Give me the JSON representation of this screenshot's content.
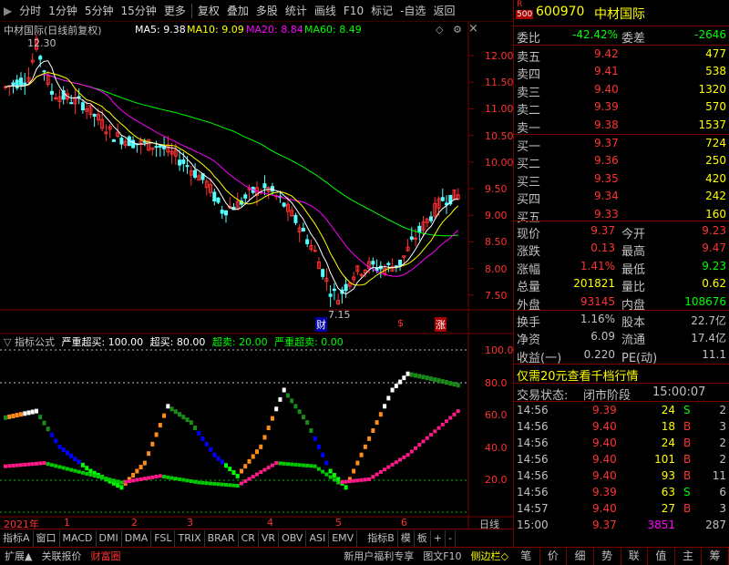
{
  "toolbar": {
    "items": [
      "分时",
      "1分钟",
      "5分钟",
      "15分钟",
      "更多",
      "复权",
      "叠加",
      "多股",
      "统计",
      "画线",
      "F10",
      "标记",
      "-自选",
      "返回"
    ]
  },
  "kline_header": {
    "title": "中材国际(日线前复权)",
    "ma5": "MA5: 9.38",
    "ma10": "MA10: 9.09",
    "ma20": "MA20: 8.84",
    "ma60": "MA60: 8.49",
    "high_mark": "12.30",
    "low_mark": "7.15",
    "ev1": "财",
    "ev2": "$",
    "ev3": "涨"
  },
  "price_axis": [
    "12.00",
    "11.50",
    "11.00",
    "10.50",
    "10.00",
    "9.50",
    "9.00",
    "8.50",
    "8.00",
    "7.50"
  ],
  "indicator": {
    "title": "指标公式",
    "p1": "严重超买: 100.00",
    "p2": "超买: 80.00",
    "p3": "超卖: 20.00",
    "p4": "严重超卖: 0.00",
    "axis": [
      "100.0",
      "80.0",
      "60.0",
      "40.0",
      "20.0"
    ]
  },
  "xaxis": {
    "labels": [
      "2021年",
      "1",
      "2",
      "3",
      "4",
      "5",
      "6"
    ],
    "period": "日线"
  },
  "tabs": [
    "指标A",
    "窗口",
    "MACD",
    "DMI",
    "DMA",
    "FSL",
    "TRIX",
    "BRAR",
    "CR",
    "VR",
    "OBV",
    "ASI",
    "EMV",
    "指标B",
    "模",
    "板",
    "+",
    "-"
  ],
  "bottom": {
    "items": [
      "扩展▲",
      "关联报价",
      "财富圈"
    ],
    "promo": "新用户福利专享",
    "f10": "图文F10",
    "side": "侧边栏◇"
  },
  "sidebar_bottom": [
    "笔",
    "价",
    "细",
    "势",
    "联",
    "值",
    "主",
    "筹"
  ],
  "quote": {
    "code": "600970",
    "name": "中材国际",
    "badge": "500",
    "rlabel": "R",
    "wb_label": "委比",
    "wb": "-42.42%",
    "wc_label": "委差",
    "wc": "-2646",
    "asks": [
      {
        "l": "卖五",
        "p": "9.42",
        "v": "477"
      },
      {
        "l": "卖四",
        "p": "9.41",
        "v": "538"
      },
      {
        "l": "卖三",
        "p": "9.40",
        "v": "1320"
      },
      {
        "l": "卖二",
        "p": "9.39",
        "v": "570"
      },
      {
        "l": "卖一",
        "p": "9.38",
        "v": "1537"
      }
    ],
    "bids": [
      {
        "l": "买一",
        "p": "9.37",
        "v": "724"
      },
      {
        "l": "买二",
        "p": "9.36",
        "v": "250"
      },
      {
        "l": "买三",
        "p": "9.35",
        "v": "420"
      },
      {
        "l": "买四",
        "p": "9.34",
        "v": "242"
      },
      {
        "l": "买五",
        "p": "9.33",
        "v": "160"
      }
    ],
    "stats": [
      {
        "l1": "现价",
        "v1": "9.37",
        "l2": "今开",
        "v2": "9.23"
      },
      {
        "l1": "涨跌",
        "v1": "0.13",
        "l2": "最高",
        "v2": "9.47"
      },
      {
        "l1": "涨幅",
        "v1": "1.41%",
        "l2": "最低",
        "v2": "9.23"
      },
      {
        "l1": "总量",
        "v1": "201821",
        "l2": "量比",
        "v2": "0.62"
      },
      {
        "l1": "外盘",
        "v1": "93145",
        "l2": "内盘",
        "v2": "108676"
      }
    ],
    "stats2": [
      {
        "l1": "换手",
        "v1": "1.16%",
        "l2": "股本",
        "v2": "22.7亿"
      },
      {
        "l1": "净资",
        "v1": "6.09",
        "l2": "流通",
        "v2": "17.4亿"
      },
      {
        "l1": "收益(一)",
        "v1": "0.220",
        "l2": "PE(动)",
        "v2": "11.1"
      }
    ],
    "promo": "仅需20元查看千档行情",
    "status_label": "交易状态:",
    "status": "闭市阶段",
    "status_time": "15:00:07",
    "ticks": [
      {
        "t": "14:56",
        "p": "9.39",
        "v": "24",
        "s": "S",
        "n": "2"
      },
      {
        "t": "14:56",
        "p": "9.40",
        "v": "18",
        "s": "B",
        "n": "3"
      },
      {
        "t": "14:56",
        "p": "9.40",
        "v": "24",
        "s": "B",
        "n": "2"
      },
      {
        "t": "14:56",
        "p": "9.40",
        "v": "101",
        "s": "B",
        "n": "2"
      },
      {
        "t": "14:56",
        "p": "9.40",
        "v": "93",
        "s": "B",
        "n": "11"
      },
      {
        "t": "14:56",
        "p": "9.39",
        "v": "63",
        "s": "S",
        "n": "6"
      },
      {
        "t": "14:57",
        "p": "9.40",
        "v": "27",
        "s": "B",
        "n": "3"
      },
      {
        "t": "15:00",
        "p": "9.37",
        "v": "3851",
        "s": "",
        "n": "287"
      }
    ]
  },
  "colors": {
    "up": "#ff3232",
    "down": "#54ffff",
    "ma5": "#ffffff",
    "ma10": "#ffff00",
    "ma20": "#ff00ff",
    "ma60": "#00ff00",
    "grid": "#7a0000",
    "yellow": "#ffff00"
  }
}
